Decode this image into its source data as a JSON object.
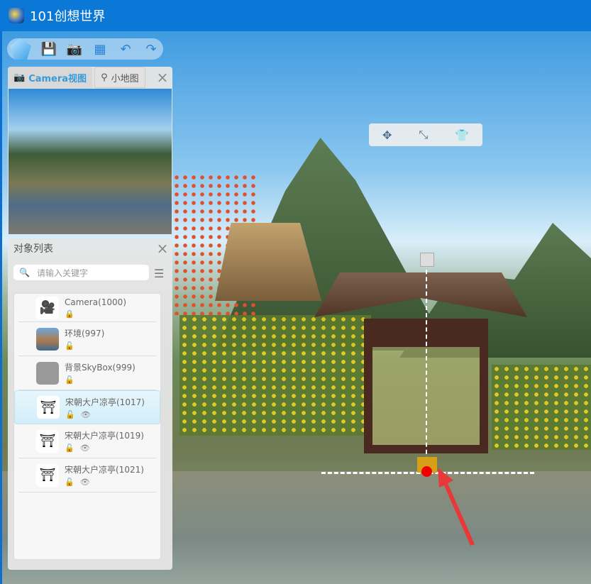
{
  "window": {
    "title": "101创想世界"
  },
  "toolbar": {
    "buttons": [
      "logo",
      "save",
      "screenshot",
      "grid",
      "undo",
      "redo"
    ]
  },
  "camera_panel": {
    "tabs": [
      {
        "label": "Camera视图",
        "active": true
      },
      {
        "label": "小地图",
        "active": false
      }
    ],
    "close": "×"
  },
  "object_panel": {
    "title": "对象列表",
    "close": "×",
    "search_placeholder": "请输入关键字",
    "items": [
      {
        "name": "Camera(1000)",
        "thumb": "🎥",
        "locked": true,
        "visible_icon": false
      },
      {
        "name": "环境(997)",
        "thumb": "env",
        "locked": false,
        "visible_icon": false
      },
      {
        "name": "背景SkyBox(999)",
        "thumb": "gray",
        "locked": false,
        "visible_icon": false
      },
      {
        "name": "宋朝大户凉亭(1017)",
        "thumb": "pavilion",
        "locked": false,
        "visible_icon": true,
        "selected": true
      },
      {
        "name": "宋朝大户凉亭(1019)",
        "thumb": "pavilion",
        "locked": false,
        "visible_icon": true
      },
      {
        "name": "宋朝大户凉亭(1021)",
        "thumb": "pavilion",
        "locked": false,
        "visible_icon": true
      }
    ]
  },
  "gizmo": {
    "buttons": [
      "move",
      "scale",
      "outfit"
    ]
  },
  "colors": {
    "titlebar": "#0b78d7",
    "accent": "#3a9ad9",
    "marker": "#e00000"
  }
}
